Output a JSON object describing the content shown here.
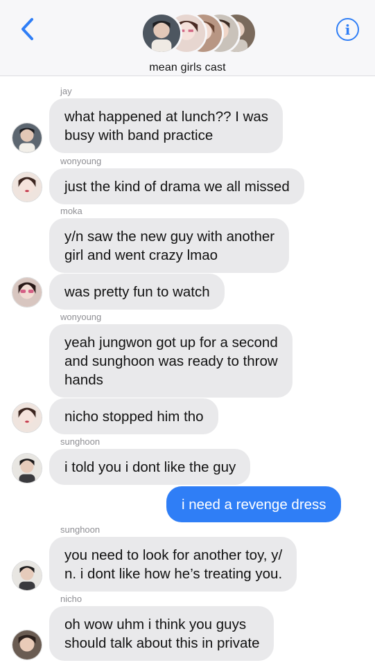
{
  "header": {
    "group_name": "mean girls cast",
    "back_icon": "chevron-left-icon",
    "info_icon": "info-icon",
    "info_label": "i",
    "accent_color": "#2f7ef6"
  },
  "messages": [
    {
      "sender": "jay",
      "text": "what happened at lunch?? I was\nbusy with band practice"
    },
    {
      "sender": "wonyoung",
      "text": "just the kind of drama we all missed"
    },
    {
      "sender": "moka",
      "text": "y/n saw the new guy with another\ngirl and went crazy lmao"
    },
    {
      "sender": "",
      "text": "was pretty fun to watch"
    },
    {
      "sender": "wonyoung",
      "text": "yeah jungwon got up for a second\nand sunghoon was ready to throw\nhands"
    },
    {
      "sender": "",
      "text": "nicho stopped him tho"
    },
    {
      "sender": "sunghoon",
      "text": "i told you i dont like the guy"
    },
    {
      "sender": "me",
      "text": "i need a revenge dress"
    },
    {
      "sender": "sunghoon",
      "text": "you need to look for another toy, y/\nn. i dont like how he’s treating you."
    },
    {
      "sender": "nicho",
      "text": "oh wow uhm i think you guys\nshould talk about this in private"
    }
  ],
  "colors": {
    "incoming_bubble": "#e9e9eb",
    "outgoing_bubble": "#2f7ef6",
    "sender_label": "#8e8e93"
  }
}
